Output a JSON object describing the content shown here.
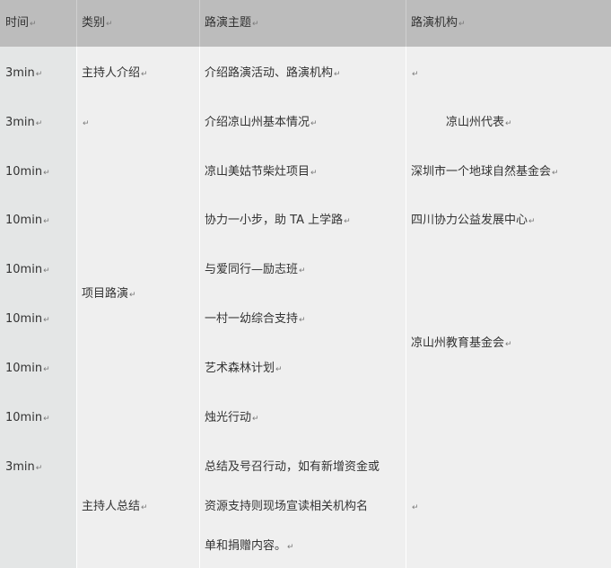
{
  "header": {
    "time": "时间",
    "category": "类别",
    "topic": "路演主题",
    "org": "路演机构"
  },
  "para_mark": "↵",
  "rows": [
    {
      "time": "3min",
      "topic": "介绍路演活动、路演机构"
    },
    {
      "time": "3min",
      "topic": "介绍凉山州基本情况"
    },
    {
      "time": "10min",
      "topic": "凉山美姑节柴灶项目"
    },
    {
      "time": "10min",
      "topic": "协力一小步，助 TA 上学路"
    },
    {
      "time": "10min",
      "topic": "与爱同行—励志班"
    },
    {
      "time": "10min",
      "topic": "一村一幼综合支持"
    },
    {
      "time": "10min",
      "topic": "艺术森林计划"
    },
    {
      "time": "10min",
      "topic": "烛光行动"
    },
    {
      "time": "3min"
    }
  ],
  "categories": {
    "host_intro": "主持人介绍",
    "project_roadshow": "项目路演",
    "host_summary": "主持人总结"
  },
  "summary_lines": [
    "总结及号召行动，如有新增资金或",
    "资源支持则现场宣读相关机构名",
    "单和捐赠内容。"
  ],
  "orgs": {
    "liangshan_rep": "凉山州代表",
    "shenzhen": "深圳市一个地球自然基金会",
    "sichuan": "四川协力公益发展中心",
    "liangshan_edu": "凉山州教育基金会"
  }
}
